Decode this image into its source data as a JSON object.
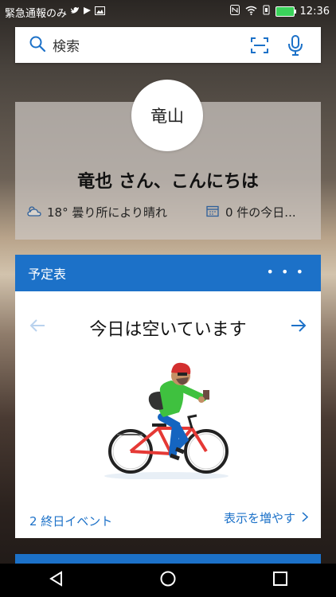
{
  "status_bar": {
    "notification_text": "緊急通報のみ",
    "time": "12:36",
    "icons": [
      "twitter-icon",
      "flag-icon",
      "gallery-icon",
      "nfc-icon",
      "wifi-icon",
      "vibrate-icon",
      "battery-icon"
    ]
  },
  "search": {
    "label": "検索",
    "icons": [
      "search-icon",
      "scan-icon",
      "mic-icon"
    ]
  },
  "greeting_card": {
    "avatar_text": "竜山",
    "greeting": "竜也 さん、こんにちは",
    "weather": "18° 曇り所により晴れ",
    "events": "0 件の今日..."
  },
  "calendar_card": {
    "title": "予定表",
    "message": "今日は空いています",
    "all_day": "2 終日イベント",
    "show_more": "表示を増やす"
  },
  "colors": {
    "accent": "#1c71c8"
  }
}
